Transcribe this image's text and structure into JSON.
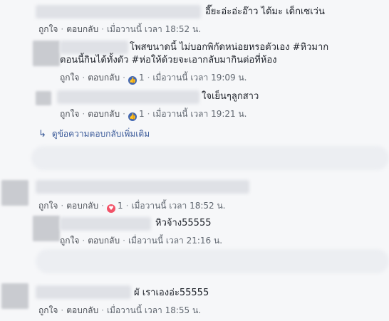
{
  "actions": {
    "like": "ถูกใจ",
    "reply": "ตอบกลับ",
    "dot": "·"
  },
  "comments": [
    {
      "text": "อี๊ยะอ่ะอ่ะอ๊าว ได้มะ เด็กเซเว่น",
      "time": "เมื่อวานนี้ เวลา 18:52 น."
    },
    {
      "text": "โพสขนาดนี้ ไม่บอกพิกัดหน่อยหรอตัวเอง #หิวมากตอนนี้กินได้ทั้งตัว #ห่อให้ด้วยจะเอากลับมากินต่อที่ห้อง",
      "reaction_count": "1",
      "time": "เมื่อวานนี้ เวลา 19:09 น."
    },
    {
      "text": "ใจเย็นๆลูกสาว",
      "reaction_count": "1",
      "time": "เมื่อวานนี้ เวลา 19:21 น."
    },
    {
      "reaction_count": "1",
      "time": "เมื่อวานนี้ เวลา 18:52 น."
    },
    {
      "text": "หิวจ้าง55555",
      "time": "เมื่อวานนี้ เวลา 21:16 น."
    },
    {
      "text": "ผั เราเองอ่ะ55555",
      "time": "เมื่อวานนี้ เวลา 18:55 น."
    }
  ],
  "more_replies": "ดูข้อความตอบกลับเพิ่มเติม",
  "colors": {
    "background": "#f6f7f9",
    "link": "#385898",
    "like_blue": "#4267b2",
    "love_red": "#f25268"
  }
}
